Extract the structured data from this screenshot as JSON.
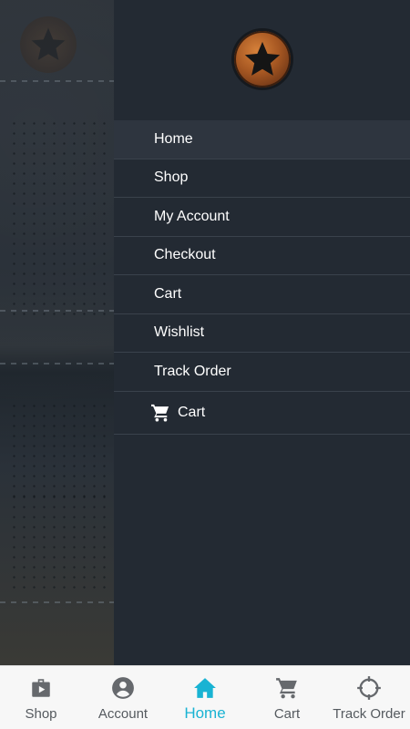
{
  "drawer": {
    "menu": [
      {
        "label": "Home",
        "active": true
      },
      {
        "label": "Shop"
      },
      {
        "label": "My Account"
      },
      {
        "label": "Checkout"
      },
      {
        "label": "Cart"
      },
      {
        "label": "Wishlist"
      },
      {
        "label": "Track Order"
      }
    ],
    "cart_link": {
      "label": "Cart",
      "icon": "cart-icon"
    },
    "logo": {
      "icon": "star-badge-icon"
    }
  },
  "bottom_nav": {
    "items": [
      {
        "label": "Shop",
        "icon": "shopping-bag-icon"
      },
      {
        "label": "Account",
        "icon": "account-circle-icon"
      },
      {
        "label": "Home",
        "icon": "home-icon",
        "active": true
      },
      {
        "label": "Cart",
        "icon": "cart-icon"
      },
      {
        "label": "Track Order",
        "icon": "crosshair-icon"
      }
    ]
  },
  "colors": {
    "drawer_bg": "#232a33",
    "active_row": "#2e353f",
    "accent": "#19b3d3",
    "nav_bg": "#f7f7f7"
  }
}
